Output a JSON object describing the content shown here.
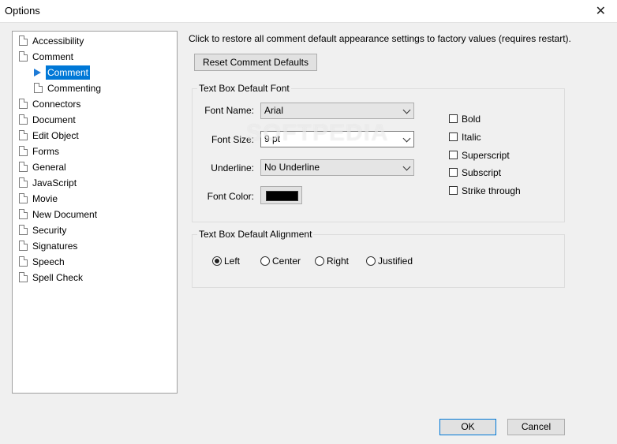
{
  "window": {
    "title": "Options"
  },
  "tree": {
    "items": [
      {
        "label": "Accessibility"
      },
      {
        "label": "Comment"
      },
      {
        "label": "Comment"
      },
      {
        "label": "Commenting"
      },
      {
        "label": "Connectors"
      },
      {
        "label": "Document"
      },
      {
        "label": "Edit Object"
      },
      {
        "label": "Forms"
      },
      {
        "label": "General"
      },
      {
        "label": "JavaScript"
      },
      {
        "label": "Movie"
      },
      {
        "label": "New Document"
      },
      {
        "label": "Security"
      },
      {
        "label": "Signatures"
      },
      {
        "label": "Speech"
      },
      {
        "label": "Spell Check"
      }
    ]
  },
  "main": {
    "info": "Click to restore all comment default appearance settings to factory values (requires restart).",
    "reset_label": "Reset Comment Defaults",
    "font_group": {
      "label": "Text Box Default Font",
      "font_name_label": "Font Name:",
      "font_name_value": "Arial",
      "font_size_label": "Font Size:",
      "font_size_value": "9 pt",
      "underline_label": "Underline:",
      "underline_value": "No Underline",
      "font_color_label": "Font Color:",
      "font_color": "#000000"
    },
    "checkboxes": [
      {
        "label": "Bold"
      },
      {
        "label": "Italic"
      },
      {
        "label": "Superscript"
      },
      {
        "label": "Subscript"
      },
      {
        "label": "Strike through"
      }
    ],
    "align_group": {
      "label": "Text Box Default Alignment",
      "options": [
        {
          "label": "Left",
          "checked": true
        },
        {
          "label": "Center",
          "checked": false
        },
        {
          "label": "Right",
          "checked": false
        },
        {
          "label": "Justified",
          "checked": false
        }
      ]
    }
  },
  "watermark": "SOFTPEDIA",
  "footer": {
    "ok_label": "OK",
    "cancel_label": "Cancel"
  }
}
